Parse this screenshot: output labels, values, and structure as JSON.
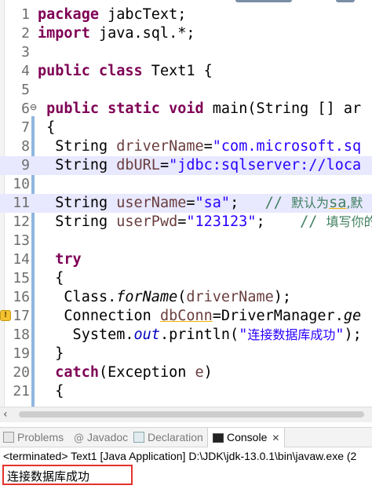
{
  "editor": {
    "lines": [
      {
        "num": "1",
        "tokens": [
          {
            "t": "package",
            "c": "kw"
          },
          {
            "t": " jabcText;"
          }
        ]
      },
      {
        "num": "2",
        "tokens": [
          {
            "t": "import",
            "c": "kw"
          },
          {
            "t": " java.sql.*;"
          }
        ]
      },
      {
        "num": "3",
        "tokens": []
      },
      {
        "num": "4",
        "tokens": [
          {
            "t": "public",
            "c": "kw"
          },
          {
            "t": " "
          },
          {
            "t": "class",
            "c": "kw"
          },
          {
            "t": " Text1 {"
          }
        ]
      },
      {
        "num": "5",
        "tokens": []
      },
      {
        "num": "6",
        "fold": "⊖",
        "tokens": [
          {
            "t": " "
          },
          {
            "t": "public",
            "c": "kw"
          },
          {
            "t": " "
          },
          {
            "t": "static",
            "c": "kw"
          },
          {
            "t": " "
          },
          {
            "t": "void",
            "c": "kw"
          },
          {
            "t": " main(String [] ar"
          }
        ]
      },
      {
        "num": "7",
        "tokens": [
          {
            "t": " {"
          }
        ]
      },
      {
        "num": "8",
        "tokens": [
          {
            "t": "  String "
          },
          {
            "t": "driverName",
            "c": "var"
          },
          {
            "t": "="
          },
          {
            "t": "\"com.microsoft.sq",
            "c": "str"
          }
        ]
      },
      {
        "num": "9",
        "highlight": true,
        "tokens": [
          {
            "t": "  String "
          },
          {
            "t": "dbURL",
            "c": "var"
          },
          {
            "t": "="
          },
          {
            "t": "\"jdbc:sqlserver://loca",
            "c": "str"
          }
        ]
      },
      {
        "num": "10",
        "tokens": []
      },
      {
        "num": "11",
        "highlight": true,
        "tokens": [
          {
            "t": "  String "
          },
          {
            "t": "userName",
            "c": "var"
          },
          {
            "t": "="
          },
          {
            "t": "\"sa\"",
            "c": "str"
          },
          {
            "t": ";   "
          },
          {
            "t": "// ",
            "c": "cm"
          },
          {
            "t": "默认为",
            "c": "cm cjk"
          },
          {
            "t": "sa",
            "c": "cm ul"
          },
          {
            "t": ",默",
            "c": "cm cjk"
          }
        ]
      },
      {
        "num": "12",
        "tokens": [
          {
            "t": "  String "
          },
          {
            "t": "userPwd",
            "c": "var"
          },
          {
            "t": "="
          },
          {
            "t": "\"123123\"",
            "c": "str"
          },
          {
            "t": ";    "
          },
          {
            "t": "// ",
            "c": "cm"
          },
          {
            "t": "填写你的",
            "c": "cm cjk"
          }
        ]
      },
      {
        "num": "13",
        "tokens": []
      },
      {
        "num": "14",
        "tokens": [
          {
            "t": "  "
          },
          {
            "t": "try",
            "c": "kw"
          }
        ]
      },
      {
        "num": "15",
        "tokens": [
          {
            "t": "  {"
          }
        ]
      },
      {
        "num": "16",
        "tokens": [
          {
            "t": "   Class."
          },
          {
            "t": "forName",
            "c": "it"
          },
          {
            "t": "("
          },
          {
            "t": "driverName",
            "c": "var"
          },
          {
            "t": ");"
          }
        ]
      },
      {
        "num": "17",
        "warn": true,
        "tokens": [
          {
            "t": "   Connection "
          },
          {
            "t": "dbConn",
            "c": "var ul"
          },
          {
            "t": "=DriverManager."
          },
          {
            "t": "ge",
            "c": "it"
          }
        ]
      },
      {
        "num": "18",
        "tokens": [
          {
            "t": "    System."
          },
          {
            "t": "out",
            "c": "fld"
          },
          {
            "t": ".println("
          },
          {
            "t": "\"",
            "c": "str"
          },
          {
            "t": "连接数据库成功",
            "c": "str cjk"
          },
          {
            "t": "\"",
            "c": "str"
          },
          {
            "t": ");"
          }
        ]
      },
      {
        "num": "19",
        "tokens": [
          {
            "t": "  }"
          }
        ]
      },
      {
        "num": "20",
        "tokens": [
          {
            "t": "  "
          },
          {
            "t": "catch",
            "c": "kw"
          },
          {
            "t": "(Exception "
          },
          {
            "t": "e",
            "c": "var"
          },
          {
            "t": ")"
          }
        ]
      },
      {
        "num": "21",
        "tokens": [
          {
            "t": "  {"
          }
        ]
      }
    ]
  },
  "views": {
    "tabs": [
      {
        "name": "tab-problems",
        "label": "Problems",
        "icon": "problems-icon"
      },
      {
        "name": "tab-javadoc",
        "label": "Javadoc",
        "icon": "javadoc-icon"
      },
      {
        "name": "tab-declaration",
        "label": "Declaration",
        "icon": "declaration-icon"
      },
      {
        "name": "tab-console",
        "label": "Console",
        "icon": "console-icon",
        "active": true,
        "close": "✕"
      }
    ]
  },
  "console": {
    "header": "<terminated> Text1 [Java Application] D:\\JDK\\jdk-13.0.1\\bin\\javaw.exe (2",
    "output": "连接数据库成功"
  },
  "colors": {
    "keyword": "#7f0055",
    "string": "#2a00ff",
    "variable": "#6a3e3e",
    "comment": "#3f7f5f",
    "highlight": "#e8e8ff",
    "output_box": "#e5322d"
  }
}
